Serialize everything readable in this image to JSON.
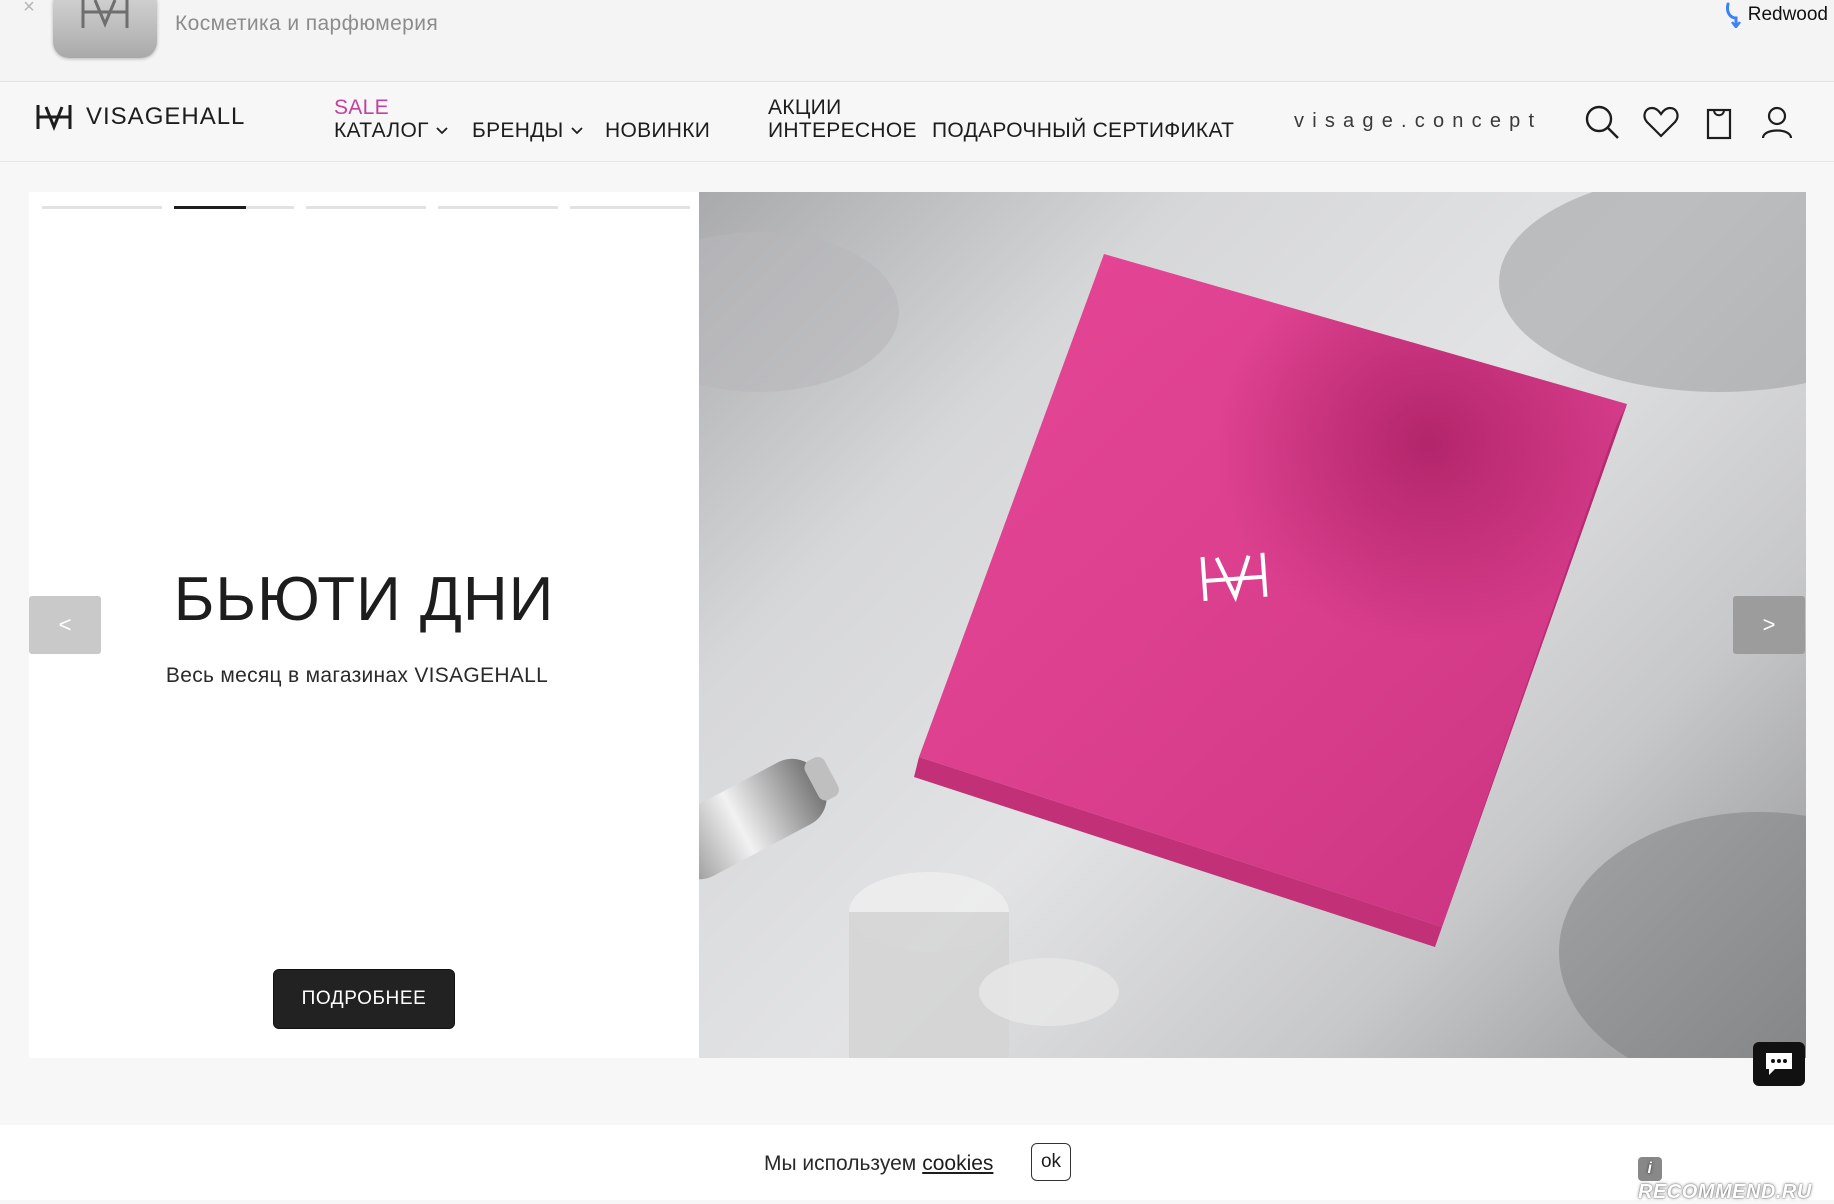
{
  "banner": {
    "close_symbol": "×",
    "app_name": "Косметика и парфюмерия",
    "redwood_label": "Redwood",
    "icons": {
      "close": "close-icon",
      "app": "app-logo-icon",
      "redwood": "redwood-icon"
    }
  },
  "header": {
    "logo_text": "VISAGEHALL",
    "nav": {
      "sale": "SALE",
      "catalog": "КАТАЛОГ",
      "brands": "БРЕНДЫ",
      "new": "НОВИНКИ",
      "promo": "АКЦИИ",
      "interesting": "ИНТЕРЕСНОЕ",
      "gift_card": "ПОДАРОЧНЫЙ СЕРТИФИКАТ"
    },
    "concept_link": "visage.concept",
    "icons": [
      "search-icon",
      "heart-icon",
      "bag-icon",
      "user-icon"
    ]
  },
  "hero": {
    "title": "БЬЮТИ ДНИ",
    "subtitle": "Весь месяц в магазинах VISAGEHALL",
    "cta_label": "ПОДРОБНЕЕ",
    "prev_label": "<",
    "next_label": ">",
    "slides_total": 5,
    "active_slide": 2,
    "active_progress": 0.6,
    "box_logo": "HVH"
  },
  "chat": {
    "icon": "chat-bubble-icon"
  },
  "cookie": {
    "text": "Мы используем",
    "link": "cookies",
    "ok_label": "ok"
  },
  "watermark": {
    "text": "RECOMMEND.RU"
  },
  "colors": {
    "accent_sale": "#c3429e",
    "box_pink": "#dd3f8f",
    "cta_bg": "#222222",
    "page_bg": "#f7f7f7"
  }
}
